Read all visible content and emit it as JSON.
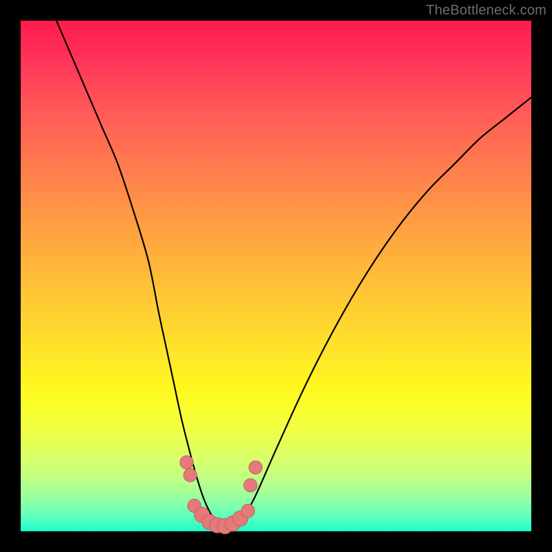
{
  "watermark": "TheBottleneck.com",
  "colors": {
    "page_bg": "#000000",
    "gradient_top": "#ff1a4d",
    "gradient_bottom": "#18ffca",
    "curve_stroke": "#000000",
    "marker_fill": "#e47a7a",
    "marker_stroke": "#c95d60"
  },
  "chart_data": {
    "type": "line",
    "title": "",
    "xlabel": "",
    "ylabel": "",
    "xlim": [
      0,
      100
    ],
    "ylim": [
      0,
      100
    ],
    "grid": false,
    "legend": false,
    "series": [
      {
        "name": "curve",
        "x": [
          7,
          10,
          13,
          16,
          19,
          22,
          25,
          27,
          28.5,
          30,
          31.5,
          33,
          34.5,
          36,
          37.5,
          39,
          40.5,
          42,
          44,
          46,
          50,
          55,
          60,
          65,
          70,
          75,
          80,
          85,
          90,
          95,
          100
        ],
        "y": [
          100,
          93,
          86,
          79,
          72,
          63,
          53,
          43,
          36,
          29,
          22,
          16,
          10.5,
          6,
          3,
          1.2,
          0.5,
          1.2,
          3.5,
          7,
          16,
          27,
          37,
          46,
          54,
          61,
          67,
          72,
          77,
          81,
          85
        ]
      }
    ],
    "markers": [
      {
        "x": 32.5,
        "y": 13.5,
        "r": 1.3
      },
      {
        "x": 33.2,
        "y": 11.0,
        "r": 1.3
      },
      {
        "x": 34.0,
        "y": 5.0,
        "r": 1.3
      },
      {
        "x": 35.5,
        "y": 3.2,
        "r": 1.5
      },
      {
        "x": 37.0,
        "y": 1.8,
        "r": 1.5
      },
      {
        "x": 38.5,
        "y": 1.2,
        "r": 1.5
      },
      {
        "x": 40.0,
        "y": 1.0,
        "r": 1.5
      },
      {
        "x": 41.5,
        "y": 1.5,
        "r": 1.5
      },
      {
        "x": 43.0,
        "y": 2.5,
        "r": 1.5
      },
      {
        "x": 44.5,
        "y": 4.0,
        "r": 1.3
      },
      {
        "x": 45.0,
        "y": 9.0,
        "r": 1.3
      },
      {
        "x": 46.0,
        "y": 12.5,
        "r": 1.3
      }
    ]
  }
}
